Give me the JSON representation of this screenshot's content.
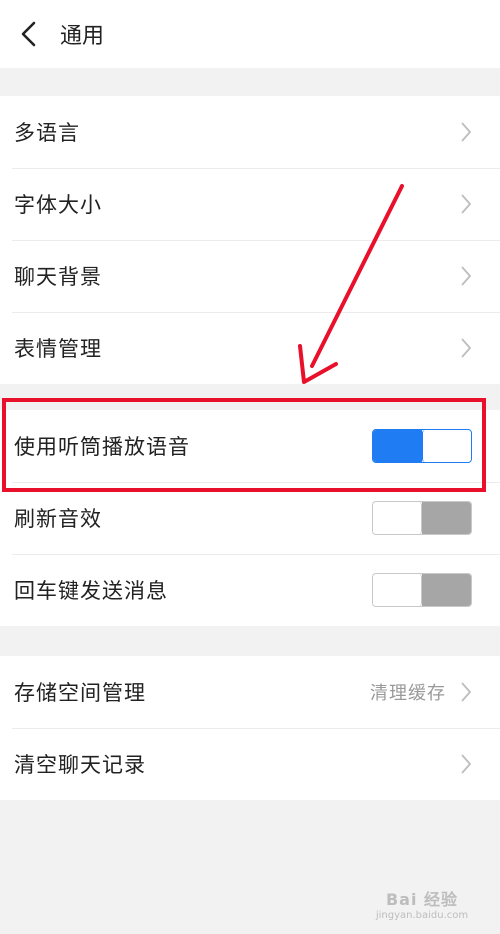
{
  "header": {
    "title": "通用"
  },
  "group1": [
    {
      "label": "多语言"
    },
    {
      "label": "字体大小"
    },
    {
      "label": "聊天背景"
    },
    {
      "label": "表情管理"
    }
  ],
  "group2": [
    {
      "label": "使用听筒播放语音",
      "toggle": "on"
    },
    {
      "label": "刷新音效",
      "toggle": "off"
    },
    {
      "label": "回车键发送消息",
      "toggle": "off"
    }
  ],
  "group3": [
    {
      "label": "存储空间管理",
      "hint": "清理缓存"
    },
    {
      "label": "清空聊天记录"
    }
  ],
  "colors": {
    "accent": "#1f7cf2",
    "highlight": "#e8102a",
    "toggle_off": "#a6a6a6"
  },
  "icons": {
    "back": "chevron-left-icon",
    "row": "chevron-right-icon"
  },
  "watermark": {
    "main": "Bai 经验",
    "sub": "jingyan.baidu.com"
  }
}
